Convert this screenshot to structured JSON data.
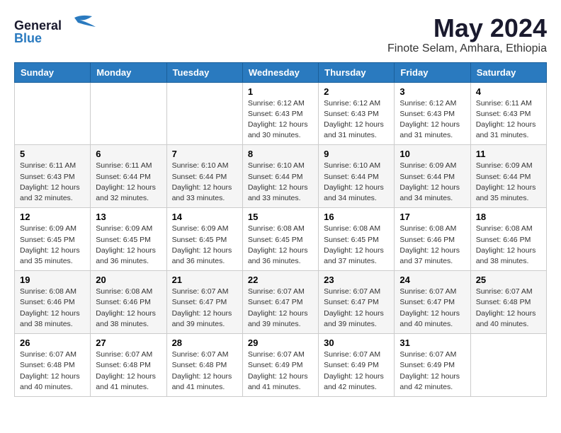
{
  "header": {
    "logo_general": "General",
    "logo_blue": "Blue",
    "month_year": "May 2024",
    "location": "Finote Selam, Amhara, Ethiopia"
  },
  "days_of_week": [
    "Sunday",
    "Monday",
    "Tuesday",
    "Wednesday",
    "Thursday",
    "Friday",
    "Saturday"
  ],
  "weeks": [
    [
      {
        "day": "",
        "info": ""
      },
      {
        "day": "",
        "info": ""
      },
      {
        "day": "",
        "info": ""
      },
      {
        "day": "1",
        "info": "Sunrise: 6:12 AM\nSunset: 6:43 PM\nDaylight: 12 hours\nand 30 minutes."
      },
      {
        "day": "2",
        "info": "Sunrise: 6:12 AM\nSunset: 6:43 PM\nDaylight: 12 hours\nand 31 minutes."
      },
      {
        "day": "3",
        "info": "Sunrise: 6:12 AM\nSunset: 6:43 PM\nDaylight: 12 hours\nand 31 minutes."
      },
      {
        "day": "4",
        "info": "Sunrise: 6:11 AM\nSunset: 6:43 PM\nDaylight: 12 hours\nand 31 minutes."
      }
    ],
    [
      {
        "day": "5",
        "info": "Sunrise: 6:11 AM\nSunset: 6:43 PM\nDaylight: 12 hours\nand 32 minutes."
      },
      {
        "day": "6",
        "info": "Sunrise: 6:11 AM\nSunset: 6:44 PM\nDaylight: 12 hours\nand 32 minutes."
      },
      {
        "day": "7",
        "info": "Sunrise: 6:10 AM\nSunset: 6:44 PM\nDaylight: 12 hours\nand 33 minutes."
      },
      {
        "day": "8",
        "info": "Sunrise: 6:10 AM\nSunset: 6:44 PM\nDaylight: 12 hours\nand 33 minutes."
      },
      {
        "day": "9",
        "info": "Sunrise: 6:10 AM\nSunset: 6:44 PM\nDaylight: 12 hours\nand 34 minutes."
      },
      {
        "day": "10",
        "info": "Sunrise: 6:09 AM\nSunset: 6:44 PM\nDaylight: 12 hours\nand 34 minutes."
      },
      {
        "day": "11",
        "info": "Sunrise: 6:09 AM\nSunset: 6:44 PM\nDaylight: 12 hours\nand 35 minutes."
      }
    ],
    [
      {
        "day": "12",
        "info": "Sunrise: 6:09 AM\nSunset: 6:45 PM\nDaylight: 12 hours\nand 35 minutes."
      },
      {
        "day": "13",
        "info": "Sunrise: 6:09 AM\nSunset: 6:45 PM\nDaylight: 12 hours\nand 36 minutes."
      },
      {
        "day": "14",
        "info": "Sunrise: 6:09 AM\nSunset: 6:45 PM\nDaylight: 12 hours\nand 36 minutes."
      },
      {
        "day": "15",
        "info": "Sunrise: 6:08 AM\nSunset: 6:45 PM\nDaylight: 12 hours\nand 36 minutes."
      },
      {
        "day": "16",
        "info": "Sunrise: 6:08 AM\nSunset: 6:45 PM\nDaylight: 12 hours\nand 37 minutes."
      },
      {
        "day": "17",
        "info": "Sunrise: 6:08 AM\nSunset: 6:46 PM\nDaylight: 12 hours\nand 37 minutes."
      },
      {
        "day": "18",
        "info": "Sunrise: 6:08 AM\nSunset: 6:46 PM\nDaylight: 12 hours\nand 38 minutes."
      }
    ],
    [
      {
        "day": "19",
        "info": "Sunrise: 6:08 AM\nSunset: 6:46 PM\nDaylight: 12 hours\nand 38 minutes."
      },
      {
        "day": "20",
        "info": "Sunrise: 6:08 AM\nSunset: 6:46 PM\nDaylight: 12 hours\nand 38 minutes."
      },
      {
        "day": "21",
        "info": "Sunrise: 6:07 AM\nSunset: 6:47 PM\nDaylight: 12 hours\nand 39 minutes."
      },
      {
        "day": "22",
        "info": "Sunrise: 6:07 AM\nSunset: 6:47 PM\nDaylight: 12 hours\nand 39 minutes."
      },
      {
        "day": "23",
        "info": "Sunrise: 6:07 AM\nSunset: 6:47 PM\nDaylight: 12 hours\nand 39 minutes."
      },
      {
        "day": "24",
        "info": "Sunrise: 6:07 AM\nSunset: 6:47 PM\nDaylight: 12 hours\nand 40 minutes."
      },
      {
        "day": "25",
        "info": "Sunrise: 6:07 AM\nSunset: 6:48 PM\nDaylight: 12 hours\nand 40 minutes."
      }
    ],
    [
      {
        "day": "26",
        "info": "Sunrise: 6:07 AM\nSunset: 6:48 PM\nDaylight: 12 hours\nand 40 minutes."
      },
      {
        "day": "27",
        "info": "Sunrise: 6:07 AM\nSunset: 6:48 PM\nDaylight: 12 hours\nand 41 minutes."
      },
      {
        "day": "28",
        "info": "Sunrise: 6:07 AM\nSunset: 6:48 PM\nDaylight: 12 hours\nand 41 minutes."
      },
      {
        "day": "29",
        "info": "Sunrise: 6:07 AM\nSunset: 6:49 PM\nDaylight: 12 hours\nand 41 minutes."
      },
      {
        "day": "30",
        "info": "Sunrise: 6:07 AM\nSunset: 6:49 PM\nDaylight: 12 hours\nand 42 minutes."
      },
      {
        "day": "31",
        "info": "Sunrise: 6:07 AM\nSunset: 6:49 PM\nDaylight: 12 hours\nand 42 minutes."
      },
      {
        "day": "",
        "info": ""
      }
    ]
  ]
}
